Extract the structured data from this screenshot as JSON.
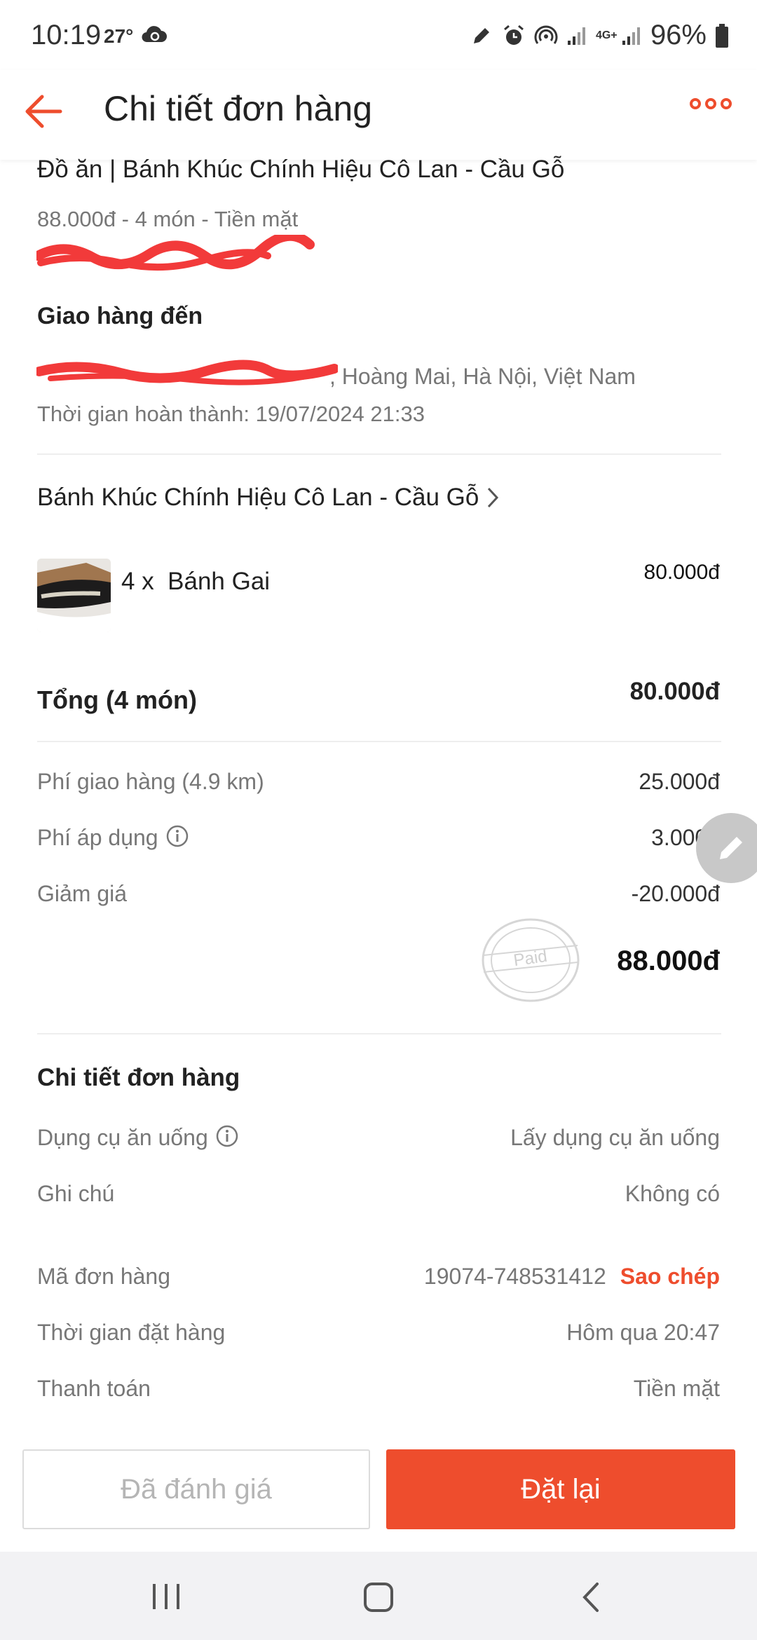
{
  "status_bar": {
    "time": "10:19",
    "temperature": "27°",
    "network": "4G+",
    "battery": "96%"
  },
  "header": {
    "title": "Chi tiết đơn hàng",
    "back_icon": "arrow-left-icon",
    "more_icon": "more-dots-icon"
  },
  "order_summary": {
    "title": "Đồ ăn | Bánh Khúc Chính Hiệu Cô Lan - Cầu Gỗ",
    "meta": "88.000đ - 4 món  - Tiền mặt"
  },
  "delivery": {
    "heading": "Giao hàng đến",
    "address_visible": ", Hoàng Mai, Hà Nội, Việt Nam",
    "completed_time": "Thời gian hoàn thành: 19/07/2024 21:33"
  },
  "store": {
    "name": "Bánh Khúc Chính Hiệu Cô Lan - Cầu Gỗ"
  },
  "items": [
    {
      "qty": "4 x",
      "name": "Bánh Gai",
      "price": "80.000đ"
    }
  ],
  "totals": {
    "subtotal_label": "Tổng (4 món)",
    "subtotal_value": "80.000đ",
    "rows": [
      {
        "label": "Phí giao hàng (4.9 km)",
        "value": "25.000đ"
      },
      {
        "label": "Phí áp dụng",
        "value": "3.000đ"
      },
      {
        "label": "Giảm giá",
        "value": "-20.000đ"
      }
    ],
    "paid_stamp": "Paid",
    "grand_total": "88.000đ"
  },
  "details": {
    "heading": "Chi tiết đơn hàng",
    "utensils_label": "Dụng cụ ăn uống",
    "utensils_value": "Lấy dụng cụ ăn uống",
    "note_label": "Ghi chú",
    "note_value": "Không có",
    "order_id_label": "Mã đơn hàng",
    "order_id_value": "19074-748531412",
    "copy_label": "Sao chép",
    "order_time_label": "Thời gian đặt hàng",
    "order_time_value": "Hôm qua 20:47",
    "payment_label": "Thanh toán",
    "payment_value": "Tiền mặt"
  },
  "actions": {
    "rated": "Đã đánh giá",
    "reorder": "Đặt lại"
  },
  "colors": {
    "accent": "#ee4d2d",
    "text": "#222222",
    "muted": "#777777",
    "divider": "#eeeeee"
  }
}
